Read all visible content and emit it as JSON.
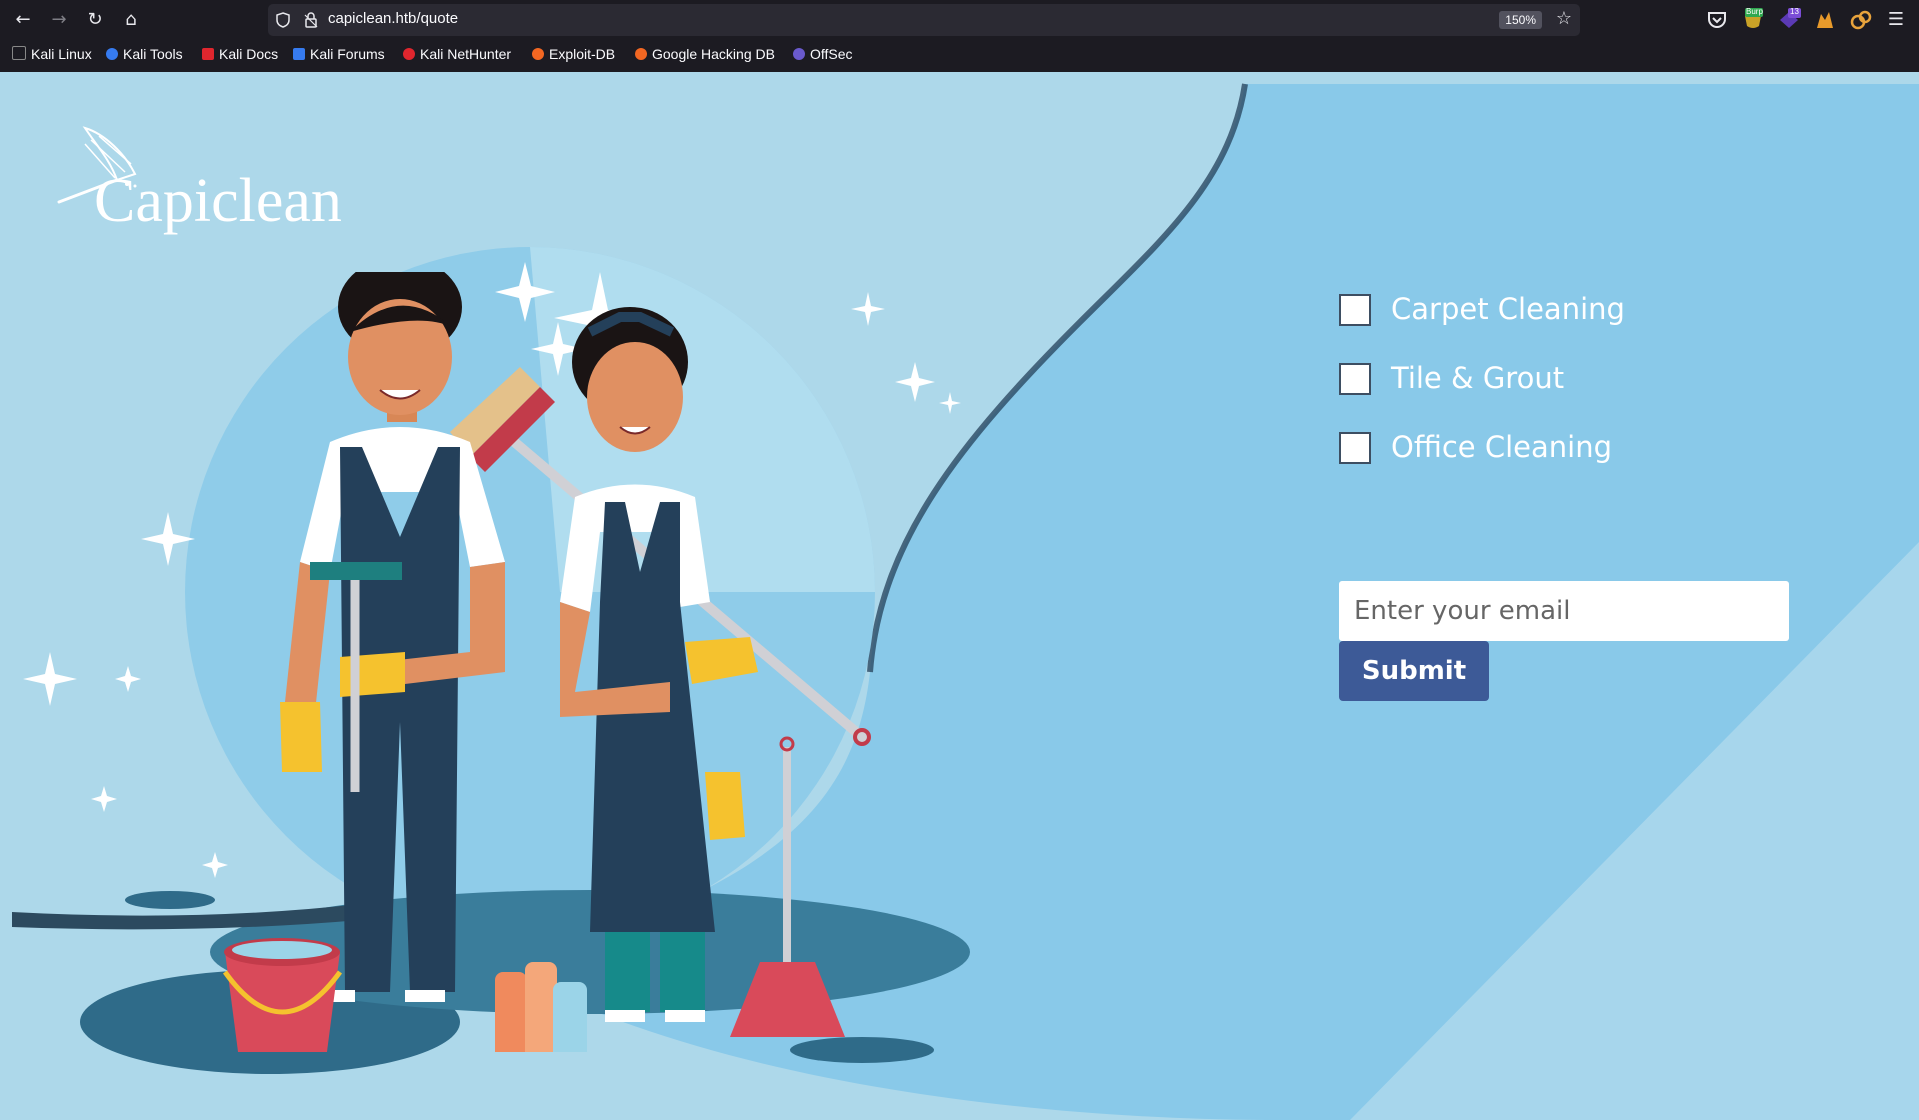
{
  "browser": {
    "url": "capiclean.htb/quote",
    "zoom": "150%",
    "bookmarks": [
      {
        "label": "Kali Linux",
        "color": "#367bf0"
      },
      {
        "label": "Kali Tools",
        "color": "#367bf0"
      },
      {
        "label": "Kali Docs",
        "color": "#e0262e"
      },
      {
        "label": "Kali Forums",
        "color": "#367bf0"
      },
      {
        "label": "Kali NetHunter",
        "color": "#e0262e"
      },
      {
        "label": "Exploit-DB",
        "color": "#f26722"
      },
      {
        "label": "Google Hacking DB",
        "color": "#f26722"
      },
      {
        "label": "OffSec",
        "color": "#6a5acd"
      }
    ],
    "extensions": {
      "burp_badge": "Burp",
      "counter_badge": "13"
    }
  },
  "page": {
    "logo_text": "Capiclean",
    "services": [
      {
        "label": "Carpet Cleaning",
        "checked": false
      },
      {
        "label": "Tile & Grout",
        "checked": false
      },
      {
        "label": "Office Cleaning",
        "checked": false
      }
    ],
    "email_placeholder": "Enter your email",
    "submit_label": "Submit"
  },
  "colors": {
    "background": "#add8ea",
    "panel": "#89c9e9",
    "button": "#3d5a97",
    "dark_shape": "#2c4a5f"
  }
}
